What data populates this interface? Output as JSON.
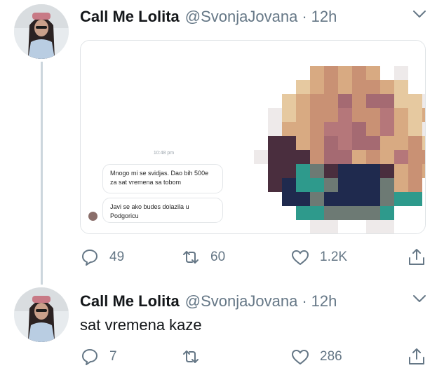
{
  "tweets": [
    {
      "display_name": "Call Me Lolita",
      "handle": "@SvonjaJovana",
      "separator": "·",
      "time": "12h",
      "media": {
        "chat_time": "10:48 pm",
        "messages": [
          "Mnogo mi se svidjas. Dao bih 500e za sat vremena sa tobom",
          "Javi se ako budes dolazila u Podgoricu"
        ]
      },
      "replies": "49",
      "retweets": "60",
      "likes": "1.2K"
    },
    {
      "display_name": "Call Me Lolita",
      "handle": "@SvonjaJovana",
      "separator": "·",
      "time": "12h",
      "text": "sat vremena kaze",
      "replies": "7",
      "retweets": "",
      "likes": "286"
    }
  ],
  "icons": {
    "reply": "speech-bubble-icon",
    "retweet": "retweet-icon",
    "like": "heart-icon",
    "share": "share-icon",
    "menu": "chevron-down-icon"
  },
  "colors": {
    "icon_gray": "#657786",
    "thread_line": "#ccd6dd"
  }
}
